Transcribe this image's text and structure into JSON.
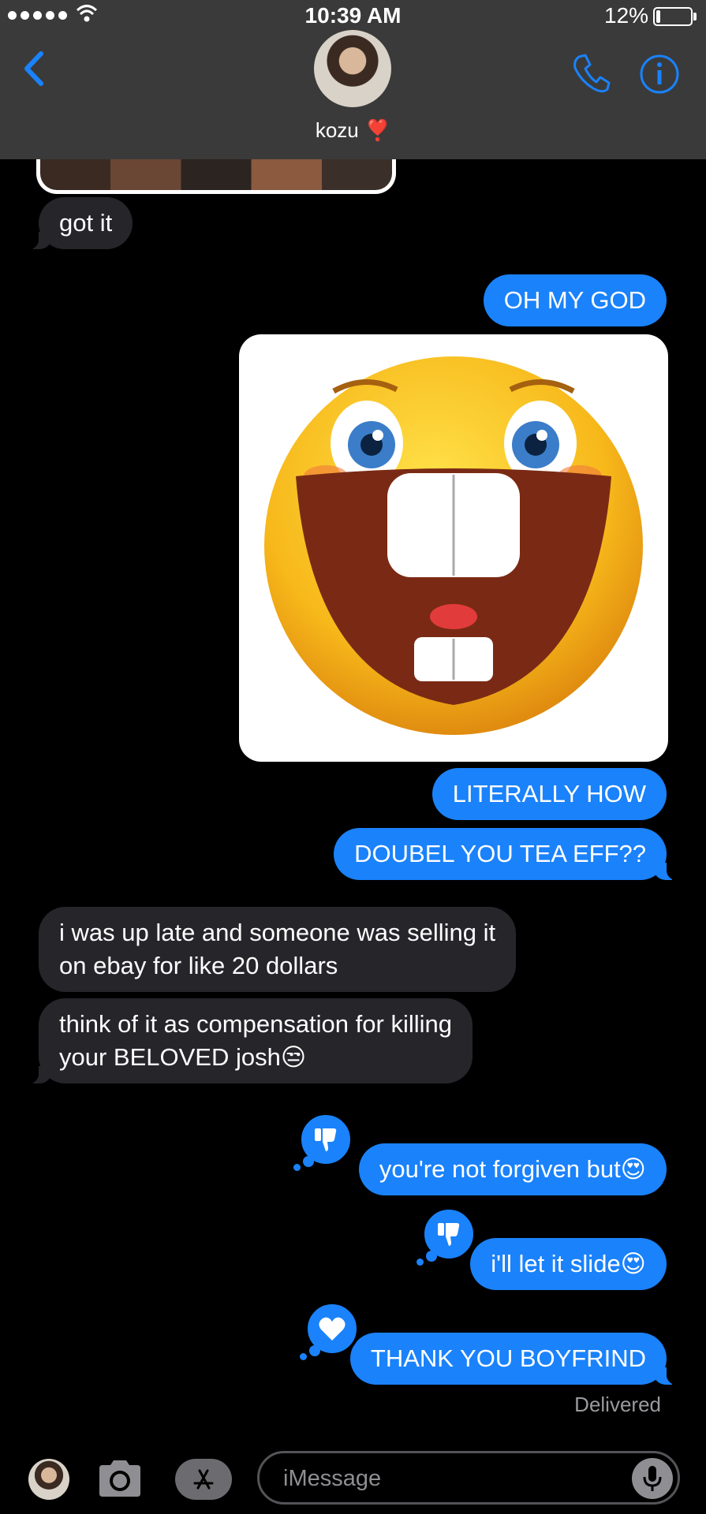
{
  "status_bar": {
    "time": "10:39 AM",
    "battery_percent": "12%",
    "battery_level": 0.12,
    "signal_dots": 5
  },
  "header": {
    "contact_name": "kozu",
    "contact_emoji": "❣️",
    "back_icon": "chevron-left-icon",
    "phone_icon": "phone-icon",
    "info_icon": "info-icon"
  },
  "messages": [
    {
      "direction": "incoming",
      "text": "got it"
    },
    {
      "direction": "outgoing",
      "text": "OH MY GOD"
    },
    {
      "direction": "outgoing",
      "type": "image",
      "image": "grinning-emoji-image"
    },
    {
      "direction": "outgoing",
      "text": "LITERALLY HOW"
    },
    {
      "direction": "outgoing",
      "text": "DOUBEL YOU TEA EFF??"
    },
    {
      "direction": "incoming",
      "text_line1": "i was up late and someone was selling it",
      "text_line2": "on ebay for like 20 dollars"
    },
    {
      "direction": "incoming",
      "text_line1": "think of it as compensation for killing",
      "text_line2": "your BELOVED josh😒"
    },
    {
      "direction": "outgoing",
      "text": "you're not forgiven but😍",
      "tapback": "thumbs-down-icon"
    },
    {
      "direction": "outgoing",
      "text": "i'll let it slide😍",
      "tapback": "thumbs-down-icon"
    },
    {
      "direction": "outgoing",
      "text": "THANK YOU BOYFRIND",
      "tapback": "heart-icon"
    }
  ],
  "delivered_label": "Delivered",
  "input_bar": {
    "placeholder": "iMessage",
    "camera_icon": "camera-icon",
    "appstore_icon": "app-store-icon",
    "mic_icon": "microphone-icon"
  },
  "colors": {
    "outgoing_bubble": "#1a82fb",
    "incoming_bubble": "#26252a",
    "header_bg": "#3a3a3a",
    "accent": "#1a82fb"
  }
}
